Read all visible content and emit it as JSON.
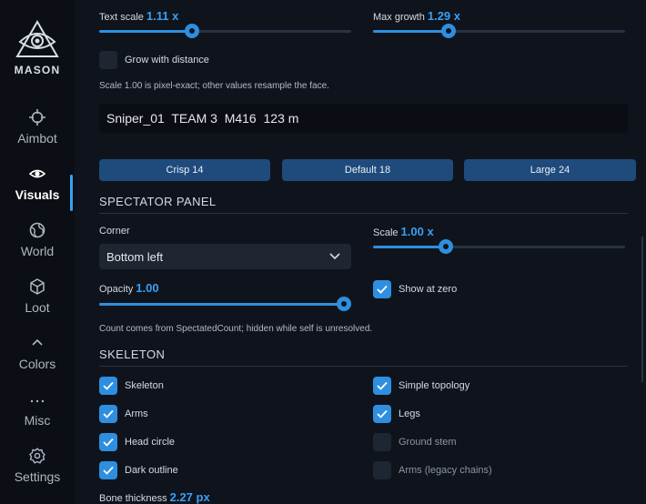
{
  "app": {
    "name": "MASON"
  },
  "sidebar": {
    "items": [
      {
        "label": "Aimbot",
        "icon": "crosshair-icon",
        "active": false
      },
      {
        "label": "Visuals",
        "icon": "eye-icon",
        "active": true
      },
      {
        "label": "World",
        "icon": "globe-icon",
        "active": false
      },
      {
        "label": "Loot",
        "icon": "box-icon",
        "active": false
      },
      {
        "label": "Colors",
        "icon": "chevron-up-icon",
        "active": false
      },
      {
        "label": "Misc",
        "icon": "ellipsis-icon",
        "active": false
      },
      {
        "label": "Settings",
        "icon": "gear-icon",
        "active": false
      }
    ]
  },
  "text_scale": {
    "label": "Text scale",
    "value": "1.11 x",
    "fraction": 0.37
  },
  "max_growth": {
    "label": "Max growth",
    "value": "1.29 x",
    "fraction": 0.29
  },
  "grow_with_distance": {
    "label": "Grow with distance",
    "checked": false
  },
  "scale_note": "Scale 1.00 is pixel-exact; other values resample the face.",
  "preview_text": "Sniper_01  TEAM 3  M416  123 m",
  "presets": [
    "Crisp 14",
    "Default 18",
    "Large 24"
  ],
  "spectator_panel": {
    "heading": "SPECTATOR PANEL",
    "corner_label": "Corner",
    "corner_value": "Bottom left",
    "scale": {
      "label": "Scale",
      "value": "1.00 x",
      "fraction": 0.29
    },
    "opacity": {
      "label": "Opacity",
      "value": "1.00",
      "fraction": 1.0
    },
    "show_at_zero": {
      "label": "Show at zero",
      "checked": true
    },
    "note": "Count comes from SpectatedCount; hidden while self is unresolved."
  },
  "skeleton": {
    "heading": "SKELETON",
    "options": [
      {
        "label": "Skeleton",
        "checked": true
      },
      {
        "label": "Simple topology",
        "checked": true
      },
      {
        "label": "Arms",
        "checked": true
      },
      {
        "label": "Legs",
        "checked": true
      },
      {
        "label": "Head circle",
        "checked": true
      },
      {
        "label": "Ground stem",
        "checked": false
      },
      {
        "label": "Dark outline",
        "checked": true
      },
      {
        "label": "Arms (legacy chains)",
        "checked": false
      }
    ],
    "bone_thickness": {
      "label": "Bone thickness",
      "value": "2.27 px"
    }
  },
  "colors": {
    "accent": "#2e8fe0",
    "value_text": "#3aa0f2",
    "button": "#1f4b7c",
    "background": "#0f141c",
    "sidebar": "#0b0f15"
  }
}
